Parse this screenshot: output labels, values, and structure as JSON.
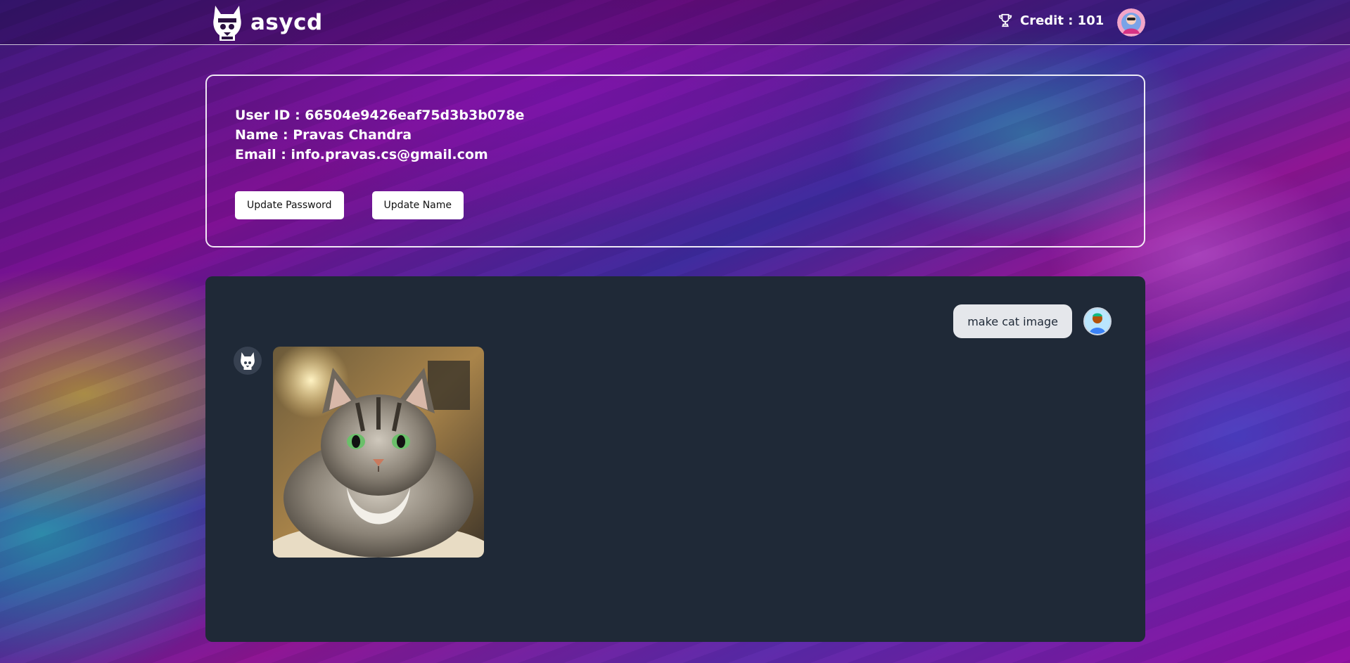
{
  "header": {
    "brand_name": "asycd",
    "brand_logo_icon": "cat-mascot-icon",
    "credit_icon": "trophy-icon",
    "credit_text": "Credit : 101",
    "profile_avatar": "user-profile-avatar"
  },
  "profile": {
    "user_id_line": "User ID : 66504e9426eaf75d3b3b078e",
    "name_line": "Name : Pravas Chandra",
    "email_line": "Email : info.pravas.cs@gmail.com",
    "update_password_label": "Update Password",
    "update_name_label": "Update Name"
  },
  "chat": {
    "messages": [
      {
        "role": "user",
        "text": "make cat image",
        "avatar": "user-avatar"
      },
      {
        "role": "bot",
        "avatar": "cat-mascot-icon",
        "content": "generated-cat-image"
      }
    ]
  },
  "colors": {
    "chat_panel_bg": "#1f2937",
    "user_bubble_bg": "#e5e7eb",
    "button_bg": "#ffffff",
    "card_border": "#ffffff"
  }
}
